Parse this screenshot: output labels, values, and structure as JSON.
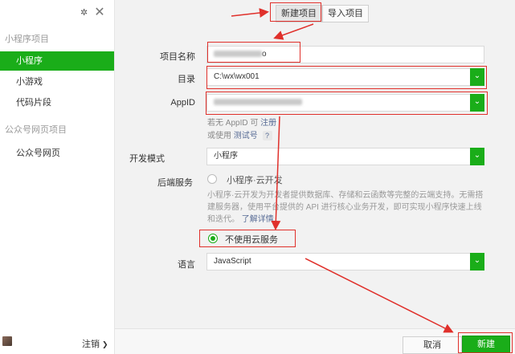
{
  "sidebar": {
    "section_mini": "小程序项目",
    "items": [
      {
        "label": "小程序",
        "active": true
      },
      {
        "label": "小游戏"
      },
      {
        "label": "代码片段"
      }
    ],
    "section_web": "公众号网页项目",
    "web_items": [
      {
        "label": "公众号网页"
      }
    ],
    "logout_label": "注销"
  },
  "tabs": {
    "new_label": "新建项目",
    "import_label": "导入项目"
  },
  "form": {
    "name_label": "项目名称",
    "name_suffix": "o",
    "dir_label": "目录",
    "dir_value": "C:\\wx\\wx001",
    "appid_label": "AppID",
    "appid_hint_prefix": "若无 AppID 可",
    "appid_hint_register": "注册",
    "appid_hint_or": "或使用",
    "appid_hint_test": "测试号",
    "appid_hint_q": "?",
    "mode_label": "开发模式",
    "mode_value": "小程序",
    "backend_label": "后端服务",
    "cloud_option": "小程序·云开发",
    "cloud_desc": "小程序·云开发为开发者提供数据库、存储和云函数等完整的云端支持。无需搭建服务器，使用平台提供的 API 进行核心业务开发，即可实现小程序快速上线和迭代。",
    "cloud_more": "了解详情",
    "no_cloud_option": "不使用云服务",
    "lang_label": "语言",
    "lang_value": "JavaScript"
  },
  "footer": {
    "cancel_label": "取消",
    "create_label": "新建"
  },
  "colors": {
    "accent": "#1aad19",
    "annotation": "#e0302b",
    "link": "#576b95"
  }
}
